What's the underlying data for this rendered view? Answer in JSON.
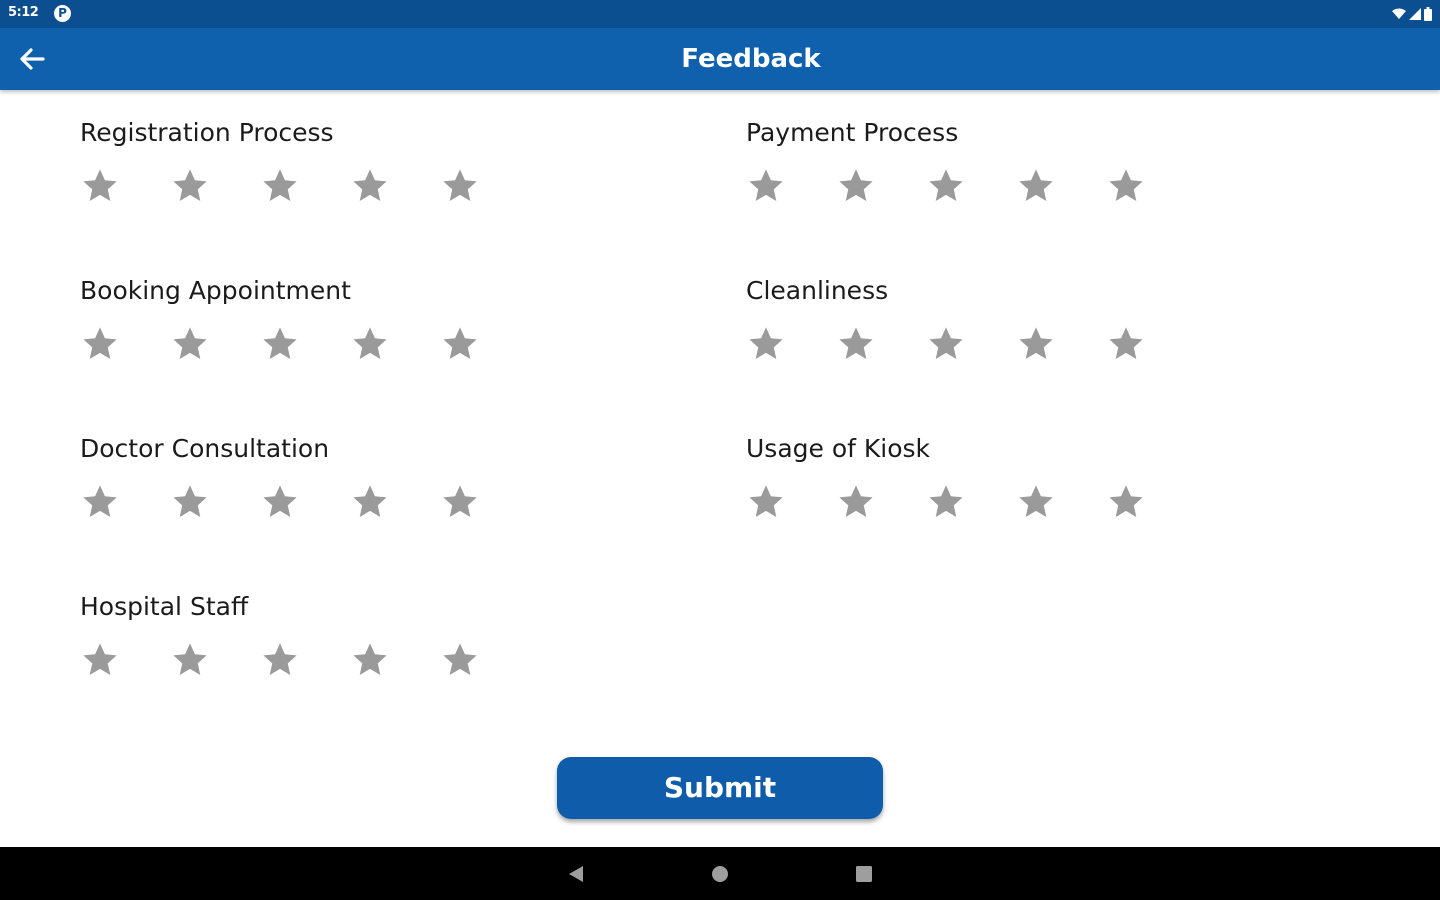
{
  "status_bar": {
    "time": "5:12",
    "app_icon_letter": "P",
    "icons": [
      "wifi-icon",
      "signal-icon",
      "battery-icon"
    ]
  },
  "app_bar": {
    "title": "Feedback",
    "back_icon": "arrow-left-icon"
  },
  "ratings": [
    {
      "label": "Registration Process",
      "stars": 5,
      "rating": 0
    },
    {
      "label": "Payment Process",
      "stars": 5,
      "rating": 0
    },
    {
      "label": "Booking Appointment",
      "stars": 5,
      "rating": 0
    },
    {
      "label": "Cleanliness",
      "stars": 5,
      "rating": 0
    },
    {
      "label": "Doctor Consultation",
      "stars": 5,
      "rating": 0
    },
    {
      "label": "Usage of Kiosk",
      "stars": 5,
      "rating": 0
    },
    {
      "label": "Hospital Staff",
      "stars": 5,
      "rating": 0
    }
  ],
  "submit": {
    "label": "Submit"
  },
  "nav_bar": {
    "buttons": [
      "back-triangle-icon",
      "home-circle-icon",
      "recents-square-icon"
    ]
  },
  "colors": {
    "status_bar": "#0b4f91",
    "app_bar": "#0f60ad",
    "star_empty": "#9a9a9a",
    "button": "#0f5cab",
    "nav_bar": "#000000"
  }
}
